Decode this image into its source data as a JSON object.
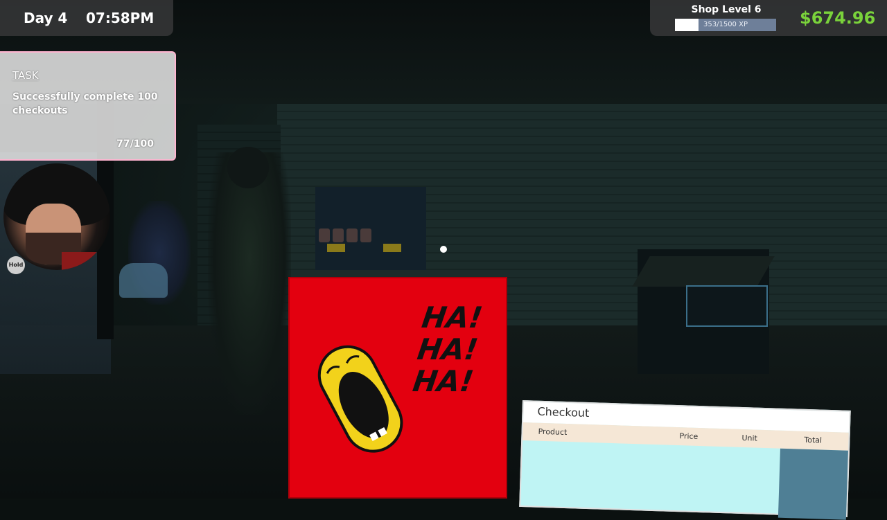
{
  "hud": {
    "day": "Day 4",
    "time": "07:58PM",
    "shop_level": "Shop Level 6",
    "xp_text": "353/1500 XP",
    "xp_fraction": 0.235,
    "money": "$674.96"
  },
  "task": {
    "title": "TASK",
    "text": "Successfully complete 100 checkouts",
    "progress": "77/100"
  },
  "webcam": {
    "hold_label": "Hold"
  },
  "meme": {
    "text": "HA! HA! HA!"
  },
  "checkout": {
    "title": "Checkout",
    "columns": [
      "Product",
      "Price",
      "Unit",
      "Total"
    ]
  },
  "colors": {
    "money": "#7ad23b",
    "meme_bg": "#e3000f",
    "checkout_bg": "#bff4f4",
    "task_border": "#ffb4d0"
  }
}
